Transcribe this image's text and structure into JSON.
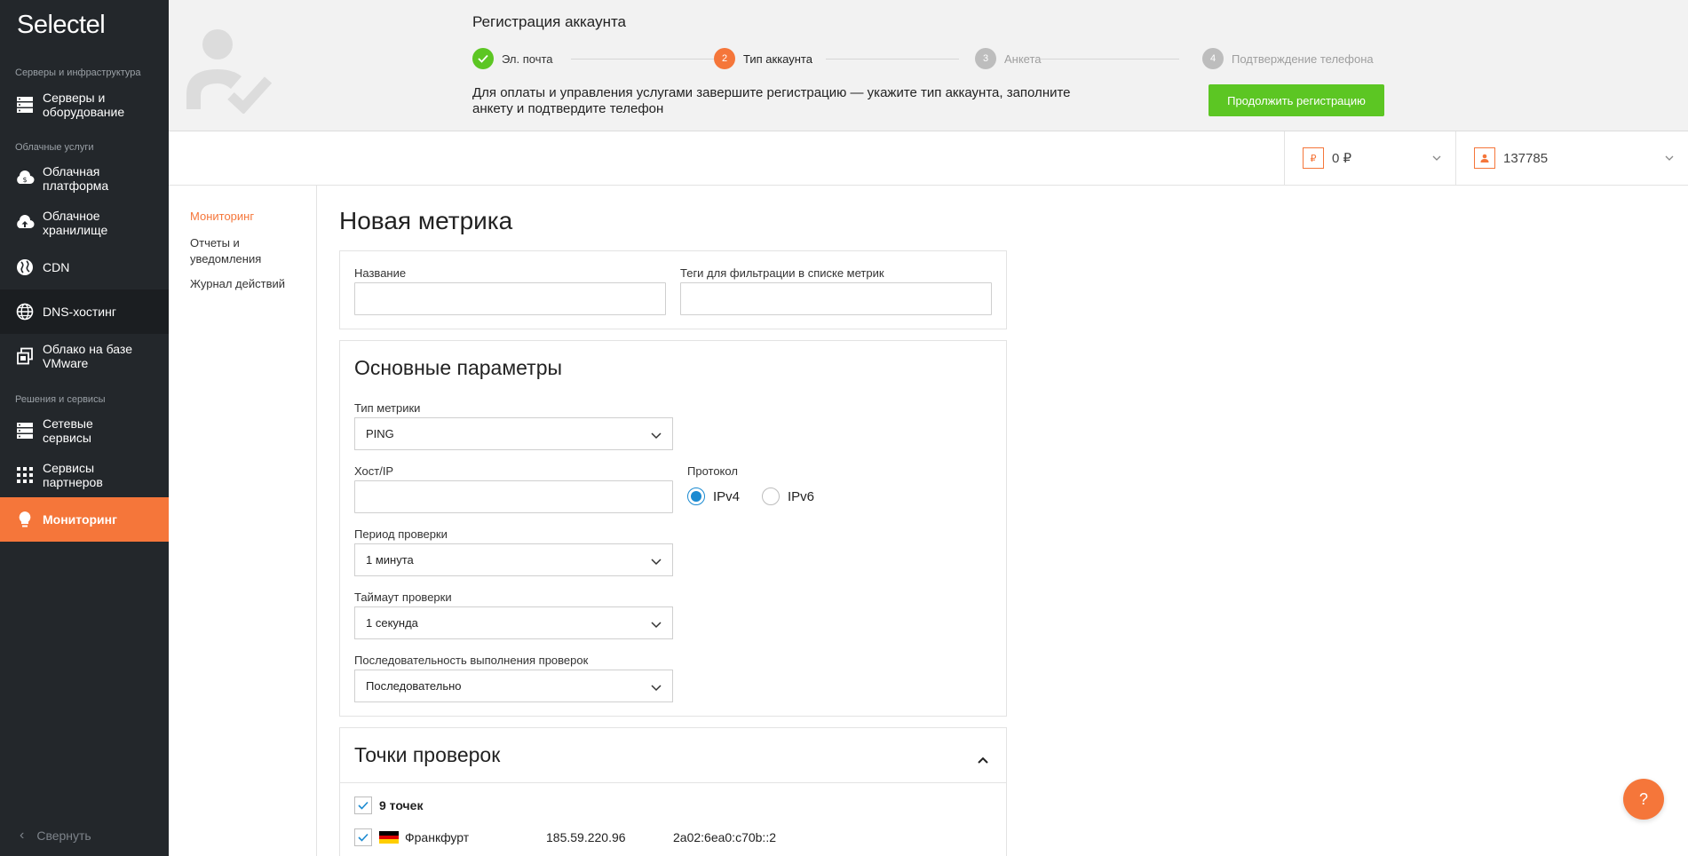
{
  "app": {
    "logo": "Selectel"
  },
  "sidebar": {
    "sections": [
      {
        "label": "Серверы и инфраструктура"
      },
      {
        "label": "Облачные услуги"
      },
      {
        "label": "Решения и сервисы"
      }
    ],
    "items": [
      {
        "label": "Серверы и оборудование",
        "icon": "servers-icon"
      },
      {
        "label": "Облачная платформа",
        "icon": "cloud-platform-icon"
      },
      {
        "label": "Облачное хранилище",
        "icon": "cloud-upload-icon"
      },
      {
        "label": "CDN",
        "icon": "globe-icon"
      },
      {
        "label": "DNS-хостинг",
        "icon": "globe-icon"
      },
      {
        "label": "Облако на базе VMware",
        "icon": "vmware-icon"
      },
      {
        "label": "Сетевые сервисы",
        "icon": "servers-icon"
      },
      {
        "label": "Сервисы партнеров",
        "icon": "grid-icon"
      },
      {
        "label": "Мониторинг",
        "icon": "lightbulb-icon"
      }
    ],
    "collapse_label": "Свернуть"
  },
  "banner": {
    "title": "Регистрация аккаунта",
    "steps": [
      {
        "num": "✓",
        "label": "Эл. почта",
        "state": "done"
      },
      {
        "num": "2",
        "label": "Тип аккаунта",
        "state": "current"
      },
      {
        "num": "3",
        "label": "Анкета",
        "state": "pending"
      },
      {
        "num": "4",
        "label": "Подтверждение телефона",
        "state": "pending"
      }
    ],
    "description": "Для оплаты и управления услугами завершите регистрацию — укажите тип аккаунта, заполните анкету и подтвердите телефон",
    "continue_label": "Продолжить регистрацию"
  },
  "topbar": {
    "balance_badge": "₽",
    "balance": "0 ₽",
    "account": "137785"
  },
  "subnav": {
    "items": [
      {
        "label": "Мониторинг"
      },
      {
        "label": "Отчеты и уведомления"
      },
      {
        "label": "Журнал действий"
      }
    ]
  },
  "main": {
    "title": "Новая метрика",
    "name_label": "Название",
    "tags_label": "Теги для фильтрации в списке метрик",
    "basic": {
      "title": "Основные параметры",
      "type_label": "Тип метрики",
      "type_value": "PING",
      "host_label": "Хост/IP",
      "protocol_label": "Протокол",
      "protocols": [
        "IPv4",
        "IPv6"
      ],
      "period_label": "Период проверки",
      "period_value": "1 минута",
      "timeout_label": "Таймаут проверки",
      "timeout_value": "1 секунда",
      "sequence_label": "Последовательность выполнения проверок",
      "sequence_value": "Последовательно"
    },
    "points": {
      "title": "Точки проверок",
      "all_label": "9 точек",
      "rows": [
        {
          "city": "Франкфурт",
          "ipv4": "185.59.220.96",
          "ipv6": "2a02:6ea0:c70b::2"
        }
      ]
    }
  },
  "help_label": "?"
}
